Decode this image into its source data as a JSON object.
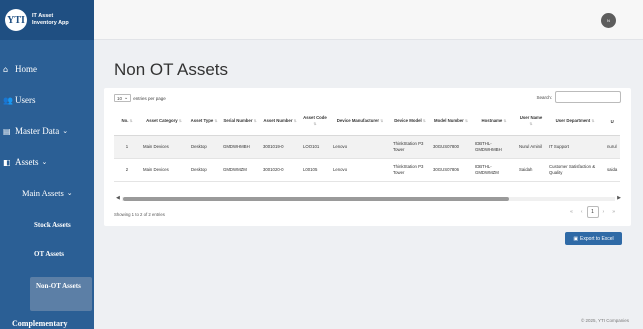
{
  "app": {
    "name_line1": "IT Asset",
    "name_line2": "Inventory App",
    "logo_text": "YTI"
  },
  "user": {
    "initial": "N"
  },
  "sidebar": {
    "home": "Home",
    "users": "Users",
    "master_data": "Master Data",
    "assets": "Assets",
    "main_assets": "Main Assets",
    "stock_assets": "Stock Assets",
    "ot_assets": "OT Assets",
    "non_ot_assets": "Non-OT Assets",
    "complementary": "Complementary"
  },
  "page": {
    "title": "Non OT Assets"
  },
  "table_controls": {
    "length_value": "10",
    "length_suffix": "entries per page",
    "search_label": "Search:"
  },
  "table": {
    "headers": [
      "No.",
      "Asset Category",
      "Asset Type",
      "Serial Number",
      "Asset Number",
      "Asset Code",
      "Device Manufacturer",
      "Device Model",
      "Model Number",
      "Hostname",
      "User Name",
      "User Department",
      "U"
    ],
    "rows": [
      [
        "1",
        "Main Devices",
        "Desktop",
        "GMDWHMBH",
        "3001019-0",
        "LOO101",
        "Lenovo",
        "ThinkStation P3 Tower",
        "30GUS07800",
        "IDBTHL-GMDWHMBH",
        "Nurul Aminil",
        "IT Support",
        "nurul"
      ],
      [
        "2",
        "Main Devices",
        "Desktop",
        "GMDWMZM",
        "3001020-0",
        "L00105",
        "Lenovo",
        "ThinkStation P3 Tower",
        "30GUS07806",
        "IDBTHL-GMDWMZM",
        "Saidah",
        "Customer Satisfaction & Quality",
        "saida"
      ]
    ]
  },
  "footer_table": {
    "info": "Showing 1 to 2 of 2 entries",
    "current_page": "1"
  },
  "pager_icons": [
    "first-icon",
    "prev-icon",
    "next-icon",
    "last-icon"
  ],
  "actions": {
    "export_label": "Export to Excel"
  },
  "footer": {
    "copyright": "© 2025, YTI Companies"
  },
  "colors": {
    "sidebar": "#2b5f95",
    "accent": "#2f6aa6"
  }
}
